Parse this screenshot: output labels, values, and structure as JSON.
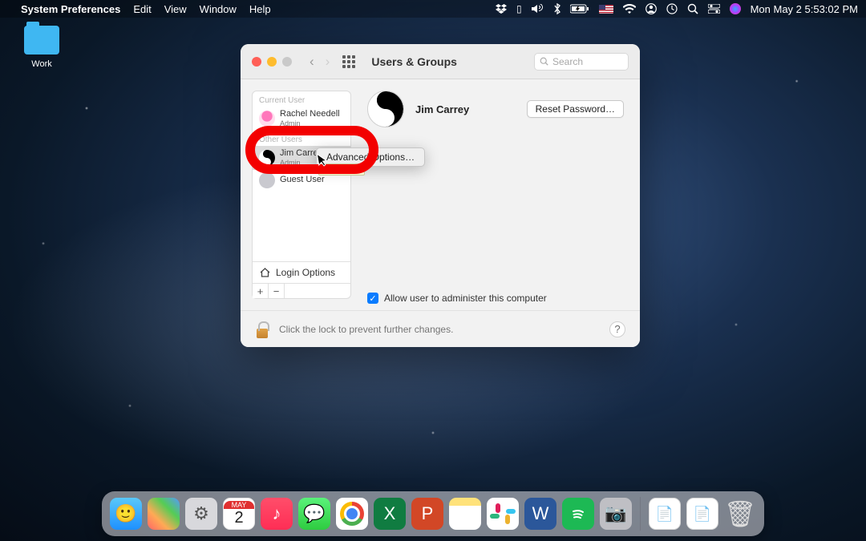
{
  "menubar": {
    "app_name": "System Preferences",
    "menus": [
      "Edit",
      "View",
      "Window",
      "Help"
    ],
    "clock": "Mon May 2  5:53:02 PM"
  },
  "desktop": {
    "folder_label": "Work"
  },
  "window": {
    "title": "Users & Groups",
    "search_placeholder": "Search",
    "sidebar": {
      "current_header": "Current User",
      "current_user": {
        "name": "Rachel Needell",
        "role": "Admin"
      },
      "other_header": "Other Users",
      "other_users": [
        {
          "name": "Jim Carrey",
          "role": "Admin"
        },
        {
          "name": "Guest User",
          "role": ""
        }
      ],
      "login_options": "Login Options"
    },
    "main": {
      "username": "Jim Carrey",
      "reset_password": "Reset Password…",
      "admin_checkbox": "Allow user to administer this computer"
    },
    "footer": {
      "lock_text": "Click the lock to prevent further changes."
    }
  },
  "context_menu": {
    "item": "Advanced Options…"
  },
  "tooltip": "Jim Carrey",
  "calendar": {
    "month": "MAY",
    "day": "2"
  }
}
